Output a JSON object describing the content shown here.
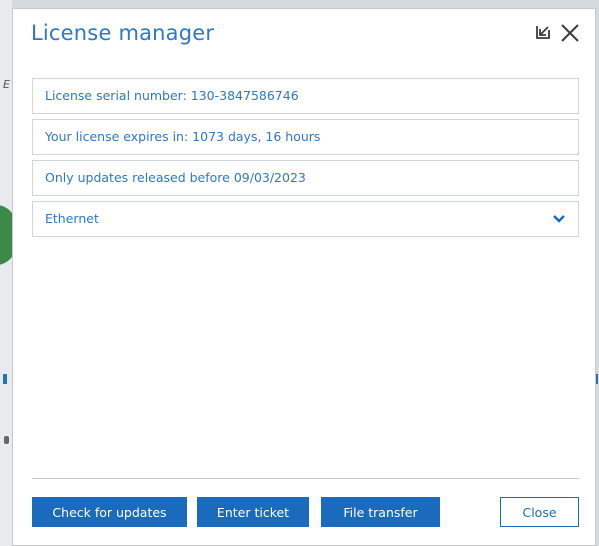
{
  "dialog": {
    "title": "License manager",
    "icons": {
      "minimize": "minimize-arrow-icon",
      "close": "close-icon"
    }
  },
  "fields": {
    "serial": "License serial number: 130-3847586746",
    "expires": "Your license expires in: 1073 days, 16 hours",
    "updates": "Only updates released before 09/03/2023",
    "connection_select": "Ethernet"
  },
  "buttons": {
    "check_updates": "Check for updates",
    "enter_ticket": "Enter ticket",
    "file_transfer": "File transfer",
    "close": "Close"
  },
  "colors": {
    "accent": "#2f78c4",
    "primary_button": "#1a6bbd",
    "border": "#cfd5da"
  }
}
